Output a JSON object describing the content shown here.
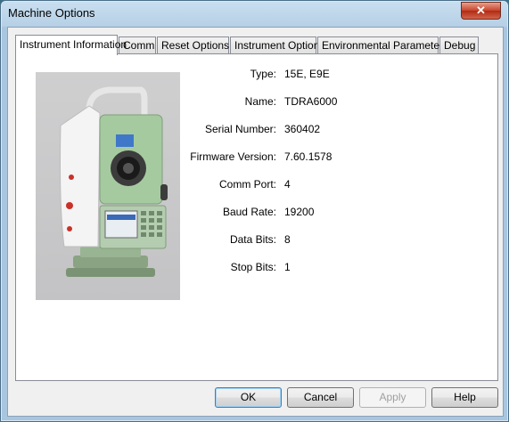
{
  "window": {
    "title": "Machine Options",
    "close_glyph": "✕"
  },
  "tabs": [
    {
      "label": "Instrument Information"
    },
    {
      "label": "Comm"
    },
    {
      "label": "Reset Options"
    },
    {
      "label": "Instrument Options"
    },
    {
      "label": "Environmental Parameters"
    },
    {
      "label": "Debug"
    }
  ],
  "info": {
    "type_label": "Type:",
    "type_value": "15E, E9E",
    "name_label": "Name:",
    "name_value": "TDRA6000",
    "serial_label": "Serial Number:",
    "serial_value": "360402",
    "firmware_label": "Firmware Version:",
    "firmware_value": "7.60.1578",
    "port_label": "Comm Port:",
    "port_value": "4",
    "baud_label": "Baud Rate:",
    "baud_value": "19200",
    "databits_label": "Data Bits:",
    "databits_value": "8",
    "stopbits_label": "Stop Bits:",
    "stopbits_value": "1"
  },
  "buttons": {
    "ok": "OK",
    "cancel": "Cancel",
    "apply": "Apply",
    "help": "Help"
  },
  "colors": {
    "instrument_green": "#9fc79a",
    "brand_red": "#c8322a"
  }
}
